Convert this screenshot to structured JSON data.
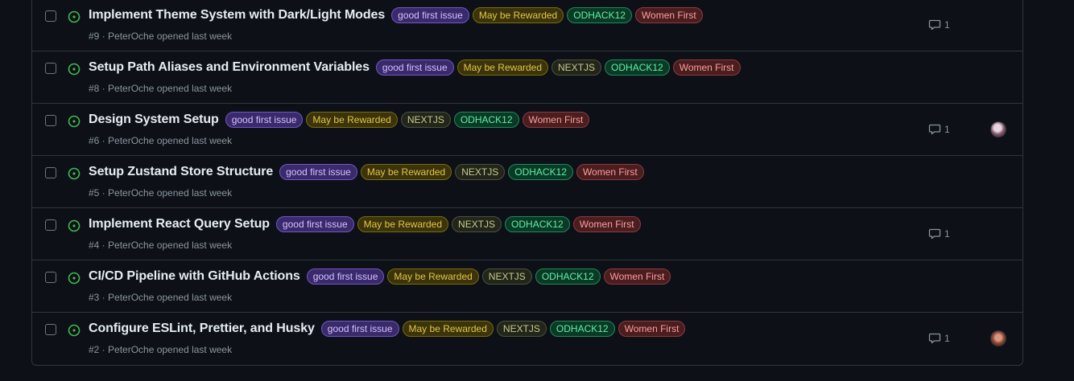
{
  "issues": [
    {
      "title": "Implement Theme System with Dark/Light Modes",
      "labels": [
        "good first issue",
        "May be Rewarded",
        "ODHACK12",
        "Women First"
      ],
      "label_types": [
        "gfi",
        "rew",
        "od",
        "wf"
      ],
      "meta": "#9 · PeterOche opened last week",
      "comments": "1",
      "avatar": ""
    },
    {
      "title": "Setup Path Aliases and Environment Variables",
      "labels": [
        "good first issue",
        "May be Rewarded",
        "NEXTJS",
        "ODHACK12",
        "Women First"
      ],
      "label_types": [
        "gfi",
        "rew",
        "next",
        "od",
        "wf"
      ],
      "meta": "#8 · PeterOche opened last week",
      "comments": "",
      "avatar": ""
    },
    {
      "title": "Design System Setup",
      "labels": [
        "good first issue",
        "May be Rewarded",
        "NEXTJS",
        "ODHACK12",
        "Women First"
      ],
      "label_types": [
        "gfi",
        "rew",
        "next",
        "od",
        "wf"
      ],
      "meta": "#6 · PeterOche opened last week",
      "comments": "1",
      "avatar": "a"
    },
    {
      "title": "Setup Zustand Store Structure",
      "labels": [
        "good first issue",
        "May be Rewarded",
        "NEXTJS",
        "ODHACK12",
        "Women First"
      ],
      "label_types": [
        "gfi",
        "rew",
        "next",
        "od",
        "wf"
      ],
      "meta": "#5 · PeterOche opened last week",
      "comments": "",
      "avatar": ""
    },
    {
      "title": "Implement React Query Setup",
      "labels": [
        "good first issue",
        "May be Rewarded",
        "NEXTJS",
        "ODHACK12",
        "Women First"
      ],
      "label_types": [
        "gfi",
        "rew",
        "next",
        "od",
        "wf"
      ],
      "meta": "#4 · PeterOche opened last week",
      "comments": "1",
      "avatar": ""
    },
    {
      "title": "CI/CD Pipeline with GitHub Actions",
      "labels": [
        "good first issue",
        "May be Rewarded",
        "NEXTJS",
        "ODHACK12",
        "Women First"
      ],
      "label_types": [
        "gfi",
        "rew",
        "next",
        "od",
        "wf"
      ],
      "meta": "#3 · PeterOche opened last week",
      "comments": "",
      "avatar": ""
    },
    {
      "title": "Configure ESLint, Prettier, and Husky",
      "labels": [
        "good first issue",
        "May be Rewarded",
        "NEXTJS",
        "ODHACK12",
        "Women First"
      ],
      "label_types": [
        "gfi",
        "rew",
        "next",
        "od",
        "wf"
      ],
      "meta": "#2 · PeterOche opened last week",
      "comments": "1",
      "avatar": "b"
    }
  ],
  "icons": {
    "status": "issue-opened-icon",
    "comment": "comment-icon"
  },
  "colors": {
    "open_status": "#3fb950",
    "background": "#0d1117",
    "border": "#30363d"
  }
}
